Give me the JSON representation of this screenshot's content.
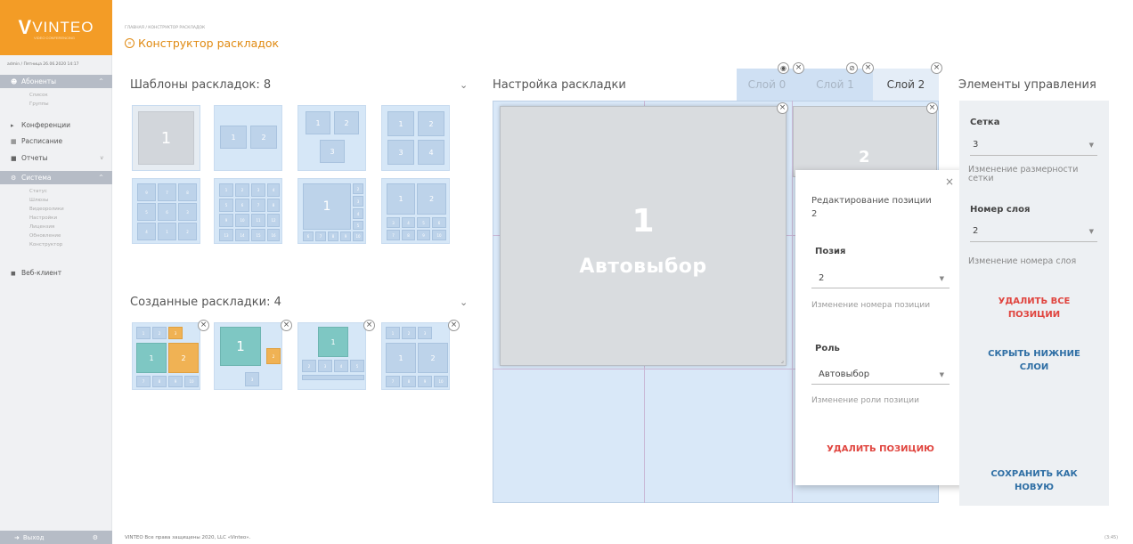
{
  "brand": {
    "logo_v": "V",
    "logo_text": "VINTEO",
    "logo_sub": "VIDEO CONFERENCING"
  },
  "user_line": "admin / Пятница 26.06.2020 14:17",
  "sidebar": {
    "items": [
      {
        "label": "Абоненты",
        "icon": "users-icon",
        "active": true,
        "chev": "^"
      },
      {
        "label": "Конференции",
        "icon": "conference-icon"
      },
      {
        "label": "Расписание",
        "icon": "calendar-icon"
      },
      {
        "label": "Отчеты",
        "icon": "report-icon",
        "chev": "v"
      },
      {
        "label": "Система",
        "icon": "settings-icon",
        "active": true,
        "chev": "^"
      },
      {
        "label": "Веб-клиент",
        "icon": "video-icon"
      }
    ],
    "sub_subscribers": [
      "Список",
      "Группы"
    ],
    "sub_system": [
      "Статус",
      "Шлюзы",
      "Видеоролики",
      "Настройки",
      "Лицензия",
      "Обновление",
      "Конструктор"
    ],
    "logout": "Выход"
  },
  "breadcrumb": "ГЛАВНАЯ / КОНСТРУКТОР РАСКЛАДОК",
  "page_title": "Конструктор раскладок",
  "templates": {
    "title": "Шаблоны раскладок: 8"
  },
  "created": {
    "title": "Созданные раскладки: 4"
  },
  "setup": {
    "title": "Настройка раскладки"
  },
  "layers": [
    {
      "label": "Слой 0"
    },
    {
      "label": "Слой 1"
    },
    {
      "label": "Слой 2"
    }
  ],
  "canvas": {
    "slot1_num": "1",
    "slot1_label": "Автовыбор",
    "slot2_num": "2"
  },
  "popup": {
    "title": "Редактирование позиции",
    "title_num": "2",
    "pos_label": "Позия",
    "pos_value": "2",
    "pos_hint": "Изменение номера позиции",
    "role_label": "Роль",
    "role_value": "Автовыбор",
    "role_hint": "Изменение роли позиции",
    "delete": "УДАЛИТЬ ПОЗИЦИЮ"
  },
  "controls": {
    "title": "Элементы управления",
    "grid_label": "Сетка",
    "grid_value": "3",
    "grid_hint": "Изменение размерности сетки",
    "layer_label": "Номер слоя",
    "layer_value": "2",
    "layer_hint": "Изменение номера слоя",
    "delete_all": "УДАЛИТЬ ВСЕ ПОЗИЦИИ",
    "hide_lower": "СКРЫТЬ НИЖНИЕ СЛОИ",
    "save_new": "СОХРАНИТЬ КАК НОВУЮ"
  },
  "footer": {
    "copyright": "VINTEO  Все права защищены 2020, LLC «Vinteo».",
    "time": "(3:45)"
  },
  "colors": {
    "accent": "#e08a12",
    "danger": "#e0453f",
    "link": "#2f6fa5",
    "sidebar_active": "#b6bcc6"
  }
}
